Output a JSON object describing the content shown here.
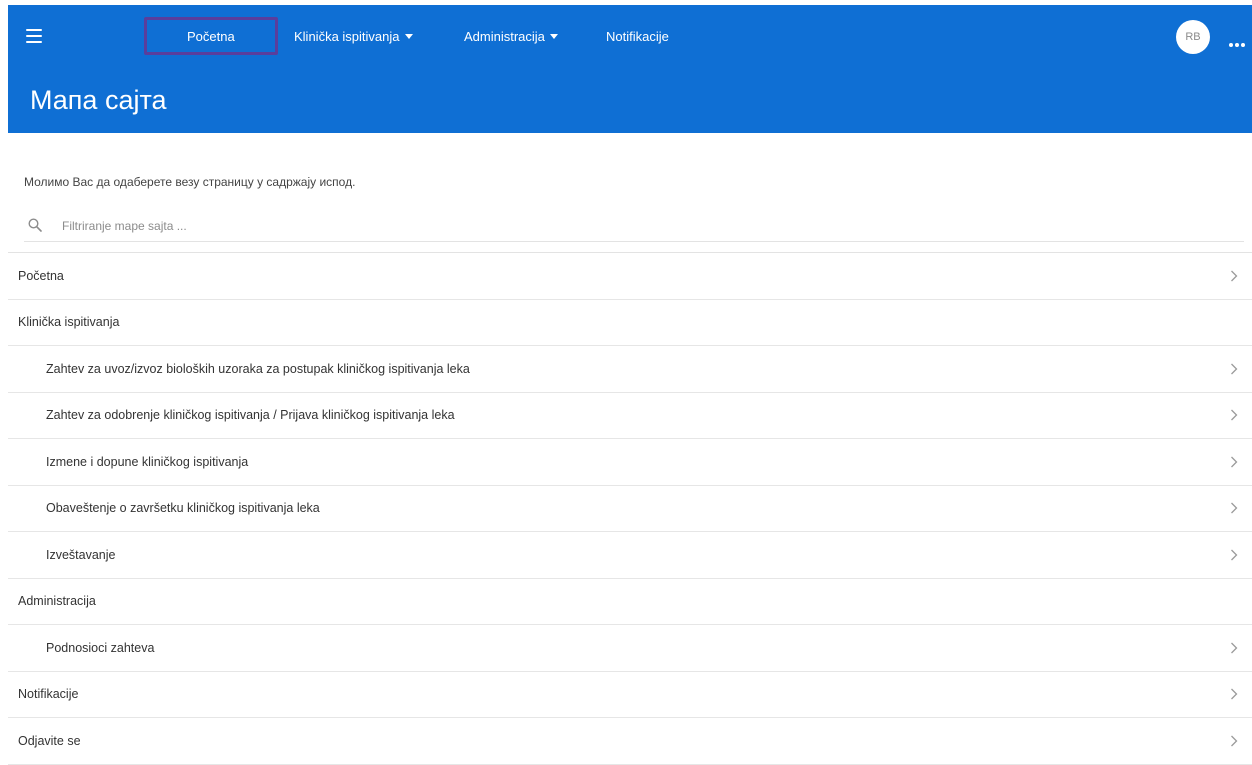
{
  "topnav": {
    "items": [
      {
        "label": "Početna",
        "has_caret": false
      },
      {
        "label": "Klinička ispitivanja",
        "has_caret": true
      },
      {
        "label": "Administracija",
        "has_caret": true
      },
      {
        "label": "Notifikacije",
        "has_caret": false
      }
    ],
    "avatar_initials": "RB",
    "menu_icon": "hamburger-icon",
    "more_icon": "ellipsis-icon"
  },
  "page": {
    "title": "Мапа сајта",
    "intro": "Молимо Вас да одаберете везу страницу у садржају испод."
  },
  "search": {
    "placeholder": "Filtriranje mape sajta ...",
    "value": "",
    "icon": "search-icon"
  },
  "sitemap": {
    "items": [
      {
        "label": "Početna",
        "level": 0,
        "link": true
      },
      {
        "label": "Klinička ispitivanja",
        "level": 0,
        "link": false
      },
      {
        "label": "Zahtev za uvoz/izvoz bioloških uzoraka za postupak kliničkog ispitivanja leka",
        "level": 1,
        "link": true
      },
      {
        "label": "Zahtev za odobrenje kliničkog ispitivanja / Prijava kliničkog ispitivanja leka",
        "level": 1,
        "link": true
      },
      {
        "label": "Izmene i dopune kliničkog ispitivanja",
        "level": 1,
        "link": true
      },
      {
        "label": "Obaveštenje o završetku kliničkog ispitivanja leka",
        "level": 1,
        "link": true
      },
      {
        "label": "Izveštavanje",
        "level": 1,
        "link": true
      },
      {
        "label": "Administracija",
        "level": 0,
        "link": false
      },
      {
        "label": "Podnosioci zahteva",
        "level": 1,
        "link": true
      },
      {
        "label": "Notifikacije",
        "level": 0,
        "link": true
      },
      {
        "label": "Odjavite se",
        "level": 0,
        "link": true
      }
    ]
  },
  "colors": {
    "header_bg": "#0f6fd4",
    "active_outline": "#5a3e9c"
  }
}
